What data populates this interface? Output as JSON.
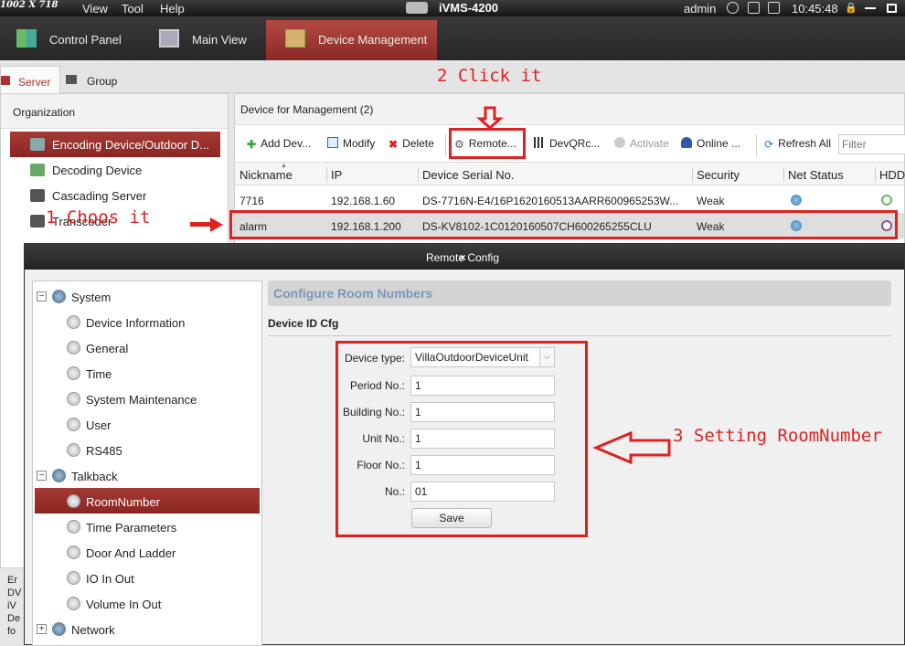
{
  "menubar": {
    "resolution_text": "1002 X 718",
    "items": [
      "View",
      "Tool",
      "Help"
    ],
    "app_title": "iVMS-4200",
    "user": "admin",
    "time": "10:45:48"
  },
  "tabs": [
    {
      "label": "Control Panel"
    },
    {
      "label": "Main View"
    },
    {
      "label": "Device Management"
    }
  ],
  "subtabs": [
    {
      "label": "Server"
    },
    {
      "label": "Group"
    }
  ],
  "organization": {
    "header": "Organization",
    "items": [
      {
        "label": "Encoding Device/Outdoor D..."
      },
      {
        "label": "Decoding Device"
      },
      {
        "label": "Cascading Server"
      },
      {
        "label": "Transcoder"
      }
    ]
  },
  "device_panel": {
    "header": "Device for Management (2)",
    "toolbar": {
      "add": "Add Dev...",
      "modify": "Modify",
      "delete": "Delete",
      "remote": "Remote...",
      "devqr": "DevQRc...",
      "activate": "Activate",
      "online": "Online ...",
      "refresh": "Refresh All",
      "filter_placeholder": "Filter"
    },
    "columns": [
      "Nickname",
      "IP",
      "Device Serial No.",
      "Security",
      "Net Status",
      "HDD"
    ],
    "rows": [
      {
        "nickname": "7716",
        "ip": "192.168.1.60",
        "serial": "DS-7716N-E4/16P1620160513AARR600965253W...",
        "security": "Weak"
      },
      {
        "nickname": "alarm",
        "ip": "192.168.1.200",
        "serial": "DS-KV8102-1C0120160507CH600265255CLU",
        "security": "Weak"
      }
    ]
  },
  "dialog": {
    "title": "Remote Config",
    "close": "×",
    "tree": {
      "system": "System",
      "system_children": [
        "Device Information",
        "General",
        "Time",
        "System Maintenance",
        "User",
        "RS485"
      ],
      "talkback": "Talkback",
      "talkback_children": [
        "RoomNumber",
        "Time Parameters",
        "Door And Ladder",
        "IO In Out",
        "Volume In Out"
      ],
      "network": "Network"
    },
    "config": {
      "title": "Configure Room Numbers",
      "subtitle": "Device ID Cfg",
      "device_type_label": "Device type:",
      "device_type_value": "VillaOutdoorDeviceUnit",
      "period_label": "Period No.:",
      "period_value": "1",
      "building_label": "Building No.:",
      "building_value": "1",
      "unit_label": "Unit No.:",
      "unit_value": "1",
      "floor_label": "Floor No.:",
      "floor_value": "1",
      "no_label": "No.:",
      "no_value": "01",
      "save": "Save"
    }
  },
  "background_text": [
    "Er",
    "DV",
    "iV",
    "De",
    "fo"
  ],
  "annotations": {
    "step1": "1 Choos it",
    "step2": "2 Click it",
    "step3": "3 Setting RoomNumber",
    "color": "#dd2222"
  }
}
